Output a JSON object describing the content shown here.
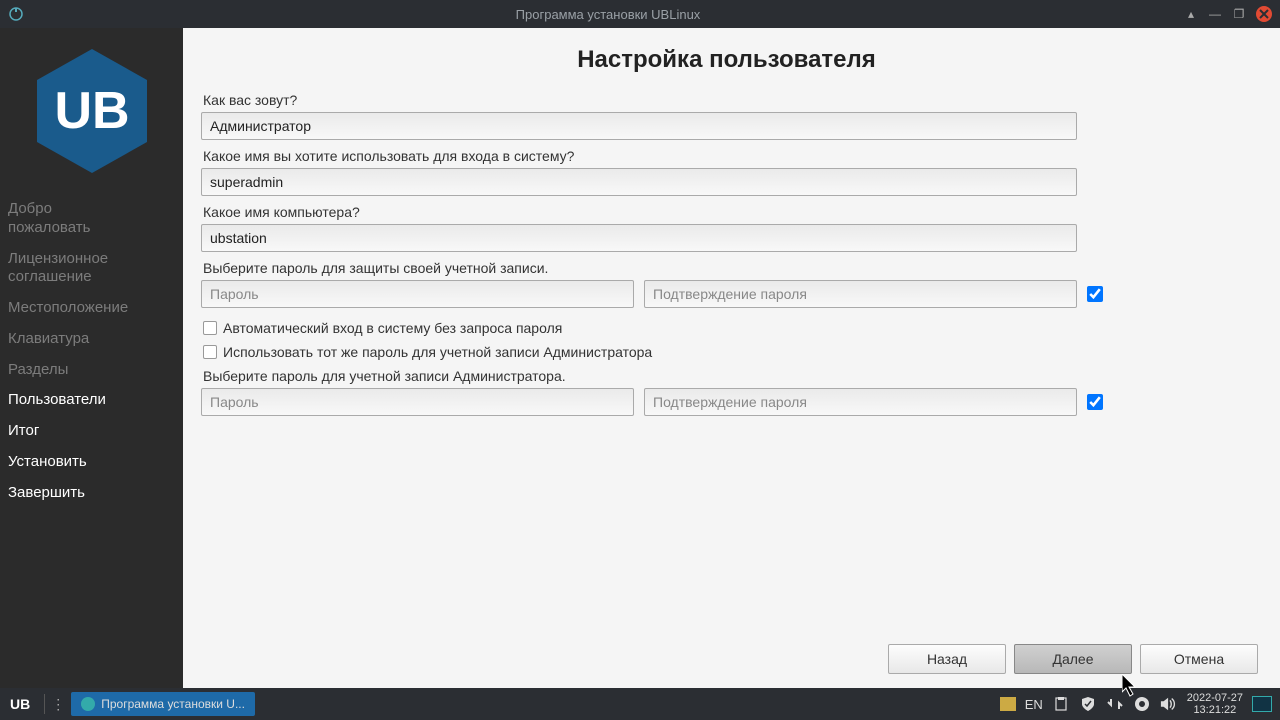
{
  "titlebar": {
    "title": "Программа установки UBLinux"
  },
  "sidebar": {
    "items": [
      {
        "label": "Добро\nпожаловать",
        "state": "past"
      },
      {
        "label": "Лицензионное\nсоглашение",
        "state": "past"
      },
      {
        "label": "Местоположение",
        "state": "past"
      },
      {
        "label": "Клавиатура",
        "state": "past"
      },
      {
        "label": "Разделы",
        "state": "past"
      },
      {
        "label": "Пользователи",
        "state": "active"
      },
      {
        "label": "Итог",
        "state": "done"
      },
      {
        "label": "Установить",
        "state": "done"
      },
      {
        "label": "Завершить",
        "state": "done"
      }
    ]
  },
  "page": {
    "title": "Настройка пользователя",
    "name_label": "Как вас зовут?",
    "name_value": "Администратор",
    "login_label": "Какое имя вы хотите использовать для входа в систему?",
    "login_value": "superadmin",
    "host_label": "Какое имя компьютера?",
    "host_value": "ubstation",
    "pw_label": "Выберите пароль для защиты своей учетной записи.",
    "pw_placeholder": "Пароль",
    "pw_confirm_placeholder": "Подтверждение пароля",
    "auto_login_label": "Автоматический вход в систему без запроса пароля",
    "same_pw_label": "Использовать тот же пароль для учетной записи Администратора",
    "admin_pw_label": "Выберите пароль для учетной записи Администратора.",
    "buttons": {
      "back": "Назад",
      "next": "Далее",
      "cancel": "Отмена"
    }
  },
  "taskbar": {
    "logo": "UB",
    "app": "Программа установки U...",
    "lang": "EN",
    "date": "2022-07-27",
    "time": "13:21:22"
  }
}
